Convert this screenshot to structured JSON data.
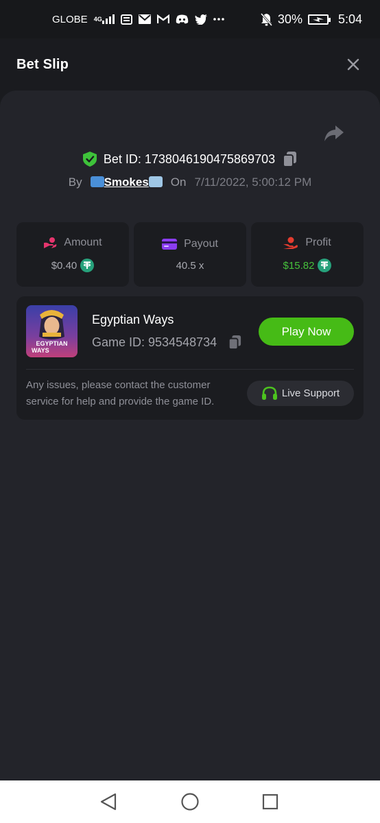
{
  "status_bar": {
    "carrier": "GLOBE",
    "network": "4G",
    "battery": "30%",
    "time": "5:04",
    "icons": [
      "signal-icon",
      "mail-icon",
      "gmail-icon",
      "discord-icon",
      "twitter-icon",
      "more-icon",
      "mute-icon",
      "battery-icon"
    ]
  },
  "header": {
    "title": "Bet Slip",
    "close_icon": "close-icon"
  },
  "bet": {
    "id_label": "Bet ID: 1738046190475869703",
    "by_label": "By",
    "username": "Smokes",
    "on_label": "On",
    "date": "7/11/2022, 5:00:12 PM"
  },
  "stats": {
    "amount": {
      "label": "Amount",
      "value": "$0.40",
      "currency_icon": "tether-icon"
    },
    "payout": {
      "label": "Payout",
      "value": "40.5 x"
    },
    "profit": {
      "label": "Profit",
      "value": "$15.82",
      "currency_icon": "tether-icon"
    }
  },
  "game": {
    "name": "Egyptian Ways",
    "id_label": "Game ID: 9534548734",
    "thumbnail_text": "EGYPTIAN WAYS",
    "play_label": "Play Now",
    "issues_text": "Any issues, please contact the customer service for help and provide the game ID.",
    "support_label": "Live Support"
  },
  "colors": {
    "background": "#1a1b1f",
    "sheet": "#23242a",
    "card": "#1b1c20",
    "accent_green": "#46bb16",
    "profit_green": "#46c13c",
    "tether": "#26a17b"
  }
}
